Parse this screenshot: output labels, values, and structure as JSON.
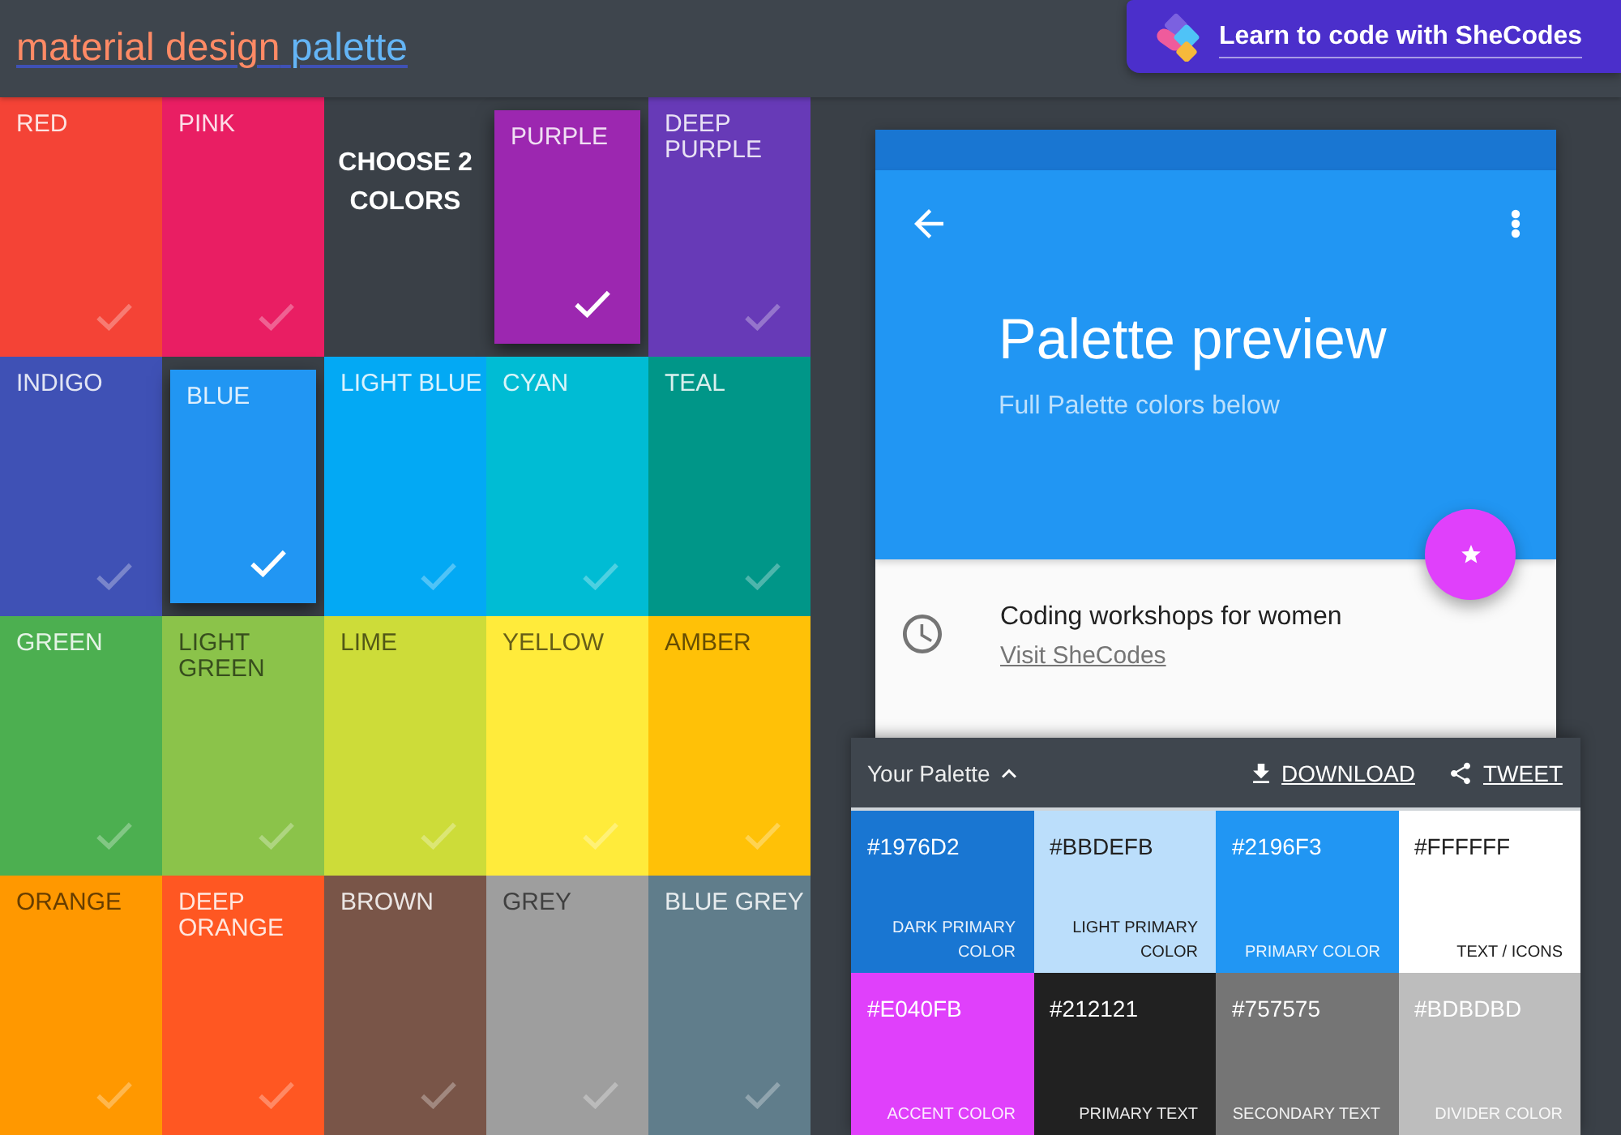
{
  "header": {
    "title_parts": [
      {
        "text": "material design",
        "color": "#ff8a65"
      },
      {
        "text": "palette",
        "color": "#64b5f6"
      }
    ],
    "banner": {
      "label": "Learn to code with SheCodes"
    }
  },
  "color_grid": [
    {
      "kind": "swatch",
      "name": "RED",
      "color": "#f44336",
      "dark_text": false,
      "selected": false
    },
    {
      "kind": "swatch",
      "name": "PINK",
      "color": "#e91e63",
      "dark_text": false,
      "selected": false
    },
    {
      "kind": "instruction",
      "text": "CHOOSE 2 COLORS"
    },
    {
      "kind": "swatch",
      "name": "PURPLE",
      "color": "#9c27b0",
      "dark_text": false,
      "selected": true
    },
    {
      "kind": "swatch",
      "name": "DEEP PURPLE",
      "color": "#673ab7",
      "dark_text": false,
      "selected": false
    },
    {
      "kind": "swatch",
      "name": "INDIGO",
      "color": "#3f51b5",
      "dark_text": false,
      "selected": false
    },
    {
      "kind": "swatch",
      "name": "BLUE",
      "color": "#2196f3",
      "dark_text": false,
      "selected": true
    },
    {
      "kind": "swatch",
      "name": "LIGHT BLUE",
      "color": "#03a9f4",
      "dark_text": false,
      "selected": false
    },
    {
      "kind": "swatch",
      "name": "CYAN",
      "color": "#00bcd4",
      "dark_text": false,
      "selected": false
    },
    {
      "kind": "swatch",
      "name": "TEAL",
      "color": "#009688",
      "dark_text": false,
      "selected": false
    },
    {
      "kind": "swatch",
      "name": "GREEN",
      "color": "#4caf50",
      "dark_text": false,
      "selected": false
    },
    {
      "kind": "swatch",
      "name": "LIGHT GREEN",
      "color": "#8bc34a",
      "dark_text": true,
      "selected": false
    },
    {
      "kind": "swatch",
      "name": "LIME",
      "color": "#cddc39",
      "dark_text": true,
      "selected": false
    },
    {
      "kind": "swatch",
      "name": "YELLOW",
      "color": "#ffeb3b",
      "dark_text": true,
      "selected": false
    },
    {
      "kind": "swatch",
      "name": "AMBER",
      "color": "#ffc107",
      "dark_text": true,
      "selected": false
    },
    {
      "kind": "swatch",
      "name": "ORANGE",
      "color": "#ff9800",
      "dark_text": true,
      "selected": false
    },
    {
      "kind": "swatch",
      "name": "DEEP ORANGE",
      "color": "#ff5722",
      "dark_text": false,
      "selected": false
    },
    {
      "kind": "swatch",
      "name": "BROWN",
      "color": "#795548",
      "dark_text": false,
      "selected": false
    },
    {
      "kind": "swatch",
      "name": "GREY",
      "color": "#9e9e9e",
      "dark_text": true,
      "selected": false
    },
    {
      "kind": "swatch",
      "name": "BLUE GREY",
      "color": "#607d8b",
      "dark_text": false,
      "selected": false
    }
  ],
  "preview": {
    "title": "Palette preview",
    "subtitle": "Full Palette colors below",
    "list_item": {
      "title": "Coding workshops for women",
      "link": "Visit SheCodes"
    }
  },
  "palette": {
    "title": "Your Palette",
    "expanded": true,
    "actions": [
      {
        "kind": "download",
        "label": "DOWNLOAD"
      },
      {
        "kind": "share",
        "label": "TWEET"
      }
    ],
    "swatches": [
      {
        "hex": "#1976D2",
        "label": "DARK PRIMARY COLOR",
        "color": "#1976d2",
        "dark_text": false
      },
      {
        "hex": "#BBDEFB",
        "label": "LIGHT PRIMARY COLOR",
        "color": "#bbdefb",
        "dark_text": true
      },
      {
        "hex": "#2196F3",
        "label": "PRIMARY COLOR",
        "color": "#2196f3",
        "dark_text": false
      },
      {
        "hex": "#FFFFFF",
        "label": "TEXT / ICONS",
        "color": "#ffffff",
        "dark_text": true
      },
      {
        "hex": "#E040FB",
        "label": "ACCENT COLOR",
        "color": "#e040fb",
        "dark_text": false
      },
      {
        "hex": "#212121",
        "label": "PRIMARY TEXT",
        "color": "#212121",
        "dark_text": false
      },
      {
        "hex": "#757575",
        "label": "SECONDARY TEXT",
        "color": "#757575",
        "dark_text": false
      },
      {
        "hex": "#BDBDBD",
        "label": "DIVIDER COLOR",
        "color": "#bdbdbd",
        "dark_text": false
      }
    ]
  }
}
